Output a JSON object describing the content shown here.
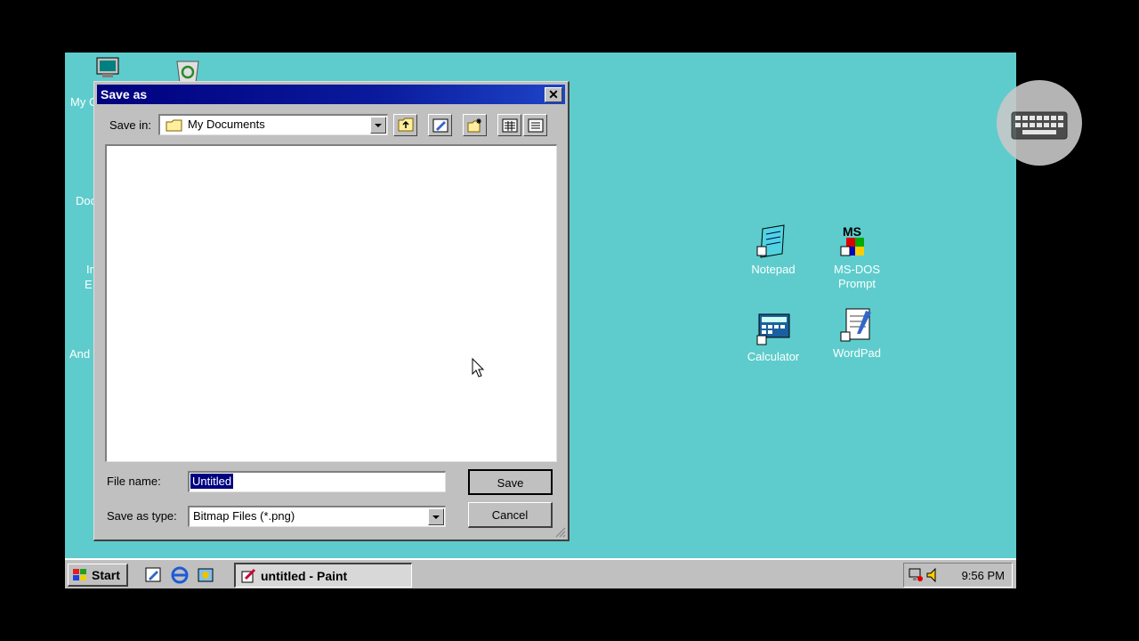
{
  "desktop": {
    "left_icons": [
      {
        "label": "My C",
        "icon": "my-computer-icon"
      },
      {
        "label": "Doc",
        "icon": "documents-icon"
      },
      {
        "label": "In",
        "icon": "internet-explorer-icon"
      },
      {
        "label": "E",
        "icon": "internet-explorer-icon"
      },
      {
        "label": "And",
        "icon": "app-icon"
      }
    ],
    "icons": [
      {
        "label": "Notepad",
        "icon": "notepad-icon"
      },
      {
        "label": "MS-DOS Prompt",
        "icon": "ms-dos-icon"
      },
      {
        "label": "Calculator",
        "icon": "calculator-icon"
      },
      {
        "label": "WordPad",
        "icon": "wordpad-icon"
      }
    ]
  },
  "dialog": {
    "title": "Save as",
    "save_in_label": "Save in:",
    "save_in_value": "My Documents",
    "file_name_label": "File name:",
    "file_name_value": "Untitled",
    "save_as_type_label": "Save as type:",
    "save_as_type_value": "Bitmap Files (*.png)",
    "save_button": "Save",
    "cancel_button": "Cancel",
    "toolbar_icons": [
      "up-one-level-icon",
      "desktop-icon",
      "new-folder-icon",
      "list-view-icon",
      "details-view-icon"
    ]
  },
  "taskbar": {
    "start_label": "Start",
    "quick_launch": [
      "desktop-icon",
      "internet-explorer-icon",
      "channels-icon"
    ],
    "task_label": "untitled - Paint",
    "clock": "9:56 PM"
  },
  "colors": {
    "desktop": "#5ecccc",
    "titlebar": "#00007f",
    "face": "#c0c0c0",
    "selection": "#000080"
  }
}
